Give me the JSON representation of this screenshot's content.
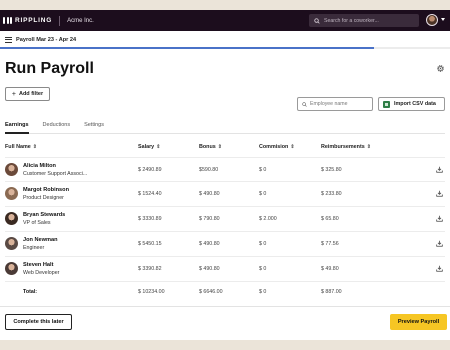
{
  "topbar": {
    "brand": "RIPPLING",
    "company": "Acme Inc.",
    "search_placeholder": "Search for a coworker..."
  },
  "subheader": {
    "period": "Payroll Mar 23 - Apr 24",
    "progress": 0.83
  },
  "page": {
    "title": "Run Payroll"
  },
  "toolbar": {
    "add_filter": "Add filter",
    "name_placeholder": "Employee name",
    "import_csv": "Import CSV data"
  },
  "tabs": [
    {
      "label": "Earnings",
      "active": true
    },
    {
      "label": "Deductions",
      "active": false
    },
    {
      "label": "Settings",
      "active": false
    }
  ],
  "table": {
    "columns": {
      "name": "Full Name",
      "salary": "Salary",
      "bonus": "Bonus",
      "commission": "Commision",
      "reimbursements": "Reimbursements"
    },
    "rows": [
      {
        "name": "Alicia Milton",
        "role": "Customer Support Associ...",
        "salary": "$ 2490.89",
        "bonus": "$590.80",
        "commission": "$ 0",
        "reimbursements": "$ 325.80",
        "avatar_color": "#6b4a3a"
      },
      {
        "name": "Margot Robinson",
        "role": "Product Designer",
        "salary": "$ 1524.40",
        "bonus": "$ 490.80",
        "commission": "$ 0",
        "reimbursements": "$ 233.80",
        "avatar_color": "#8a6a52"
      },
      {
        "name": "Bryan Stewards",
        "role": "VP of Sales",
        "salary": "$ 3330.89",
        "bonus": "$ 790.80",
        "commission": "$ 2.000",
        "reimbursements": "$ 65.80",
        "avatar_color": "#3a2a22"
      },
      {
        "name": "Jon Newman",
        "role": "Engineer",
        "salary": "$ 5450.15",
        "bonus": "$ 490.80",
        "commission": "$ 0",
        "reimbursements": "$ 77.56",
        "avatar_color": "#5a4a44"
      },
      {
        "name": "Steven Halt",
        "role": "Web Developer",
        "salary": "$ 3390.82",
        "bonus": "$ 490.80",
        "commission": "$ 0",
        "reimbursements": "$ 49.80",
        "avatar_color": "#4a3a36"
      }
    ],
    "total": {
      "label": "Total:",
      "salary": "$ 10234.00",
      "bonus": "$ 6646.00",
      "commission": "$ 0",
      "reimbursements": "$ 887.00"
    }
  },
  "footer": {
    "complete_later": "Complete this later",
    "preview": "Preview Payroll"
  },
  "colors": {
    "topbar_bg": "#1c0d1d",
    "accent_progress": "#4a72c8",
    "primary_button": "#f6c624",
    "csv_icon": "#2e7d46",
    "page_bg": "#ebe4d9"
  }
}
